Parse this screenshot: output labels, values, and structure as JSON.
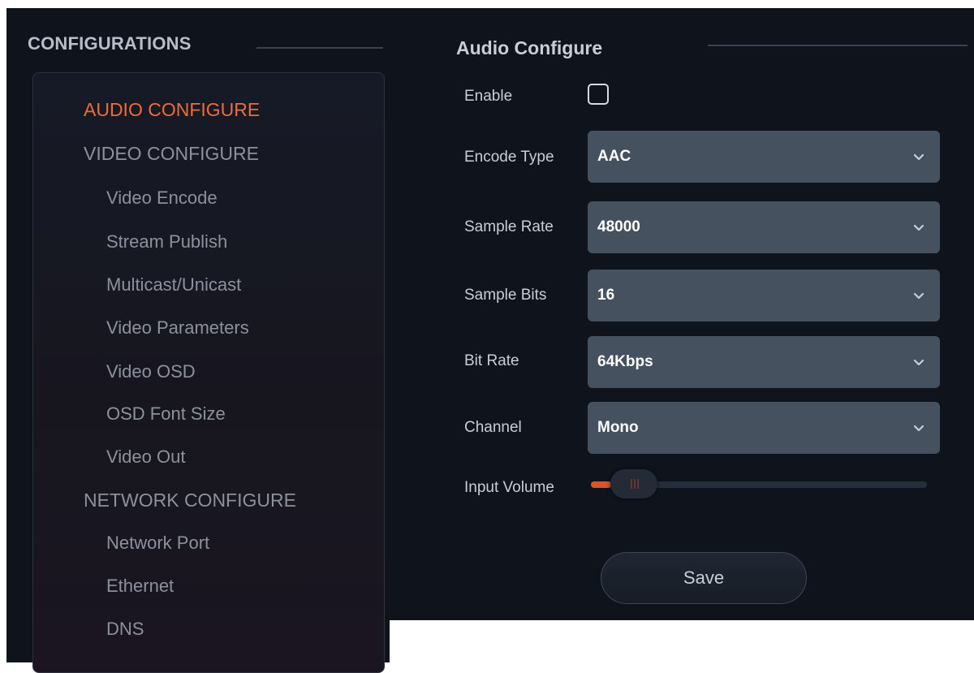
{
  "sidebar": {
    "title": "CONFIGURATIONS",
    "items": [
      {
        "label": "AUDIO CONFIGURE"
      },
      {
        "label": "VIDEO CONFIGURE"
      },
      {
        "label": "Video Encode"
      },
      {
        "label": "Stream Publish"
      },
      {
        "label": "Multicast/Unicast"
      },
      {
        "label": "Video Parameters"
      },
      {
        "label": "Video OSD"
      },
      {
        "label": "OSD Font Size"
      },
      {
        "label": "Video Out"
      },
      {
        "label": "NETWORK CONFIGURE"
      },
      {
        "label": "Network Port"
      },
      {
        "label": "Ethernet"
      },
      {
        "label": "DNS"
      }
    ]
  },
  "form": {
    "title": "Audio Configure",
    "enable": {
      "label": "Enable",
      "checked": false
    },
    "encode_type": {
      "label": "Encode Type",
      "value": "AAC"
    },
    "sample_rate": {
      "label": "Sample Rate",
      "value": "48000"
    },
    "sample_bits": {
      "label": "Sample Bits",
      "value": "16"
    },
    "bit_rate": {
      "label": "Bit Rate",
      "value": "64Kbps"
    },
    "channel": {
      "label": "Channel",
      "value": "Mono"
    },
    "input_volume": {
      "label": "Input Volume",
      "level_fraction": 0.06
    },
    "save_label": "Save"
  },
  "colors": {
    "accent": "#f06a3b",
    "background": "#0f141c",
    "select_bg": "#465160"
  },
  "icons": {
    "select_chevron": "chevron-down-icon",
    "checkbox": "checkbox-icon",
    "slider_grip": "grip-icon"
  }
}
